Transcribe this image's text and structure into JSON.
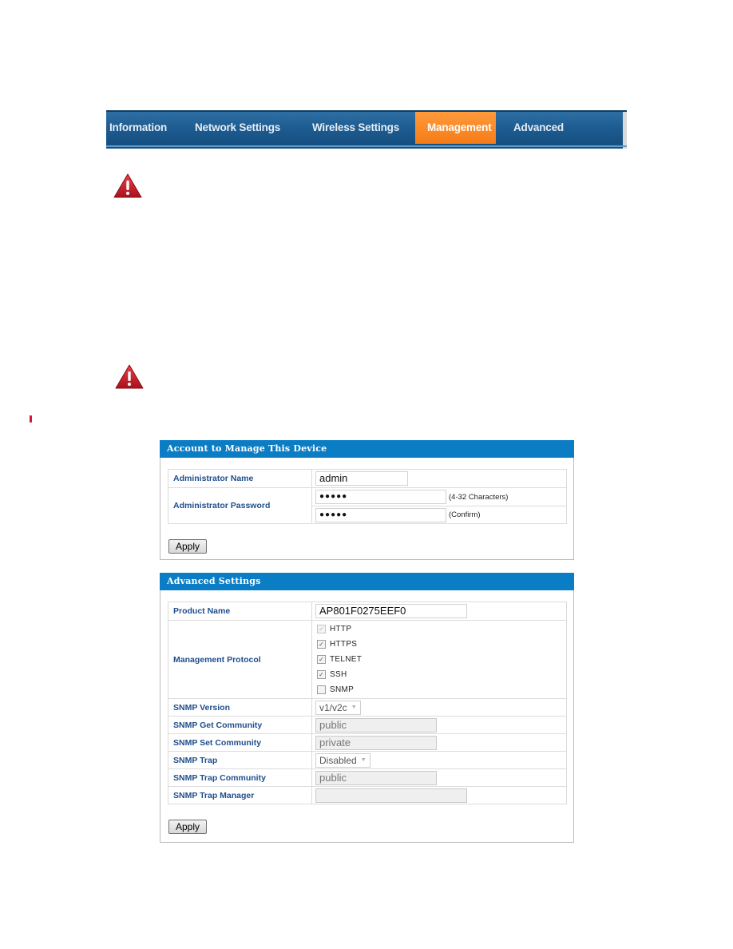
{
  "nav": {
    "items": [
      {
        "label": "Information",
        "active": false
      },
      {
        "label": "Network Settings",
        "active": false
      },
      {
        "label": "Wireless Settings",
        "active": false
      },
      {
        "label": "Management",
        "active": true
      },
      {
        "label": "Advanced",
        "active": false
      }
    ],
    "colors": {
      "bar": "#1d5b90",
      "active": "#f57c17"
    }
  },
  "icons": {
    "warning_1": "warning-triangle-icon",
    "warning_2": "warning-triangle-icon"
  },
  "account_panel": {
    "title": "Account to Manage This Device",
    "admin_name_label": "Administrator Name",
    "admin_name_value": "admin",
    "admin_password_label": "Administrator Password",
    "password_mask": "●●●●●",
    "password_hint": "(4-32 Characters)",
    "confirm_mask": "●●●●●",
    "confirm_hint": "(Confirm)",
    "apply_label": "Apply"
  },
  "advanced_panel": {
    "title": "Advanced Settings",
    "product_name_label": "Product Name",
    "product_name_value": "AP801F0275EEF0",
    "mgmt_protocol_label": "Management Protocol",
    "protocols": [
      {
        "label": "HTTP",
        "checked": true,
        "disabled": true
      },
      {
        "label": "HTTPS",
        "checked": true,
        "disabled": false
      },
      {
        "label": "TELNET",
        "checked": true,
        "disabled": false
      },
      {
        "label": "SSH",
        "checked": true,
        "disabled": false
      },
      {
        "label": "SNMP",
        "checked": false,
        "disabled": false
      }
    ],
    "snmp_version_label": "SNMP Version",
    "snmp_version_value": "v1/v2c",
    "snmp_get_label": "SNMP Get Community",
    "snmp_get_value": "public",
    "snmp_set_label": "SNMP Set Community",
    "snmp_set_value": "private",
    "snmp_trap_label": "SNMP Trap",
    "snmp_trap_value": "Disabled",
    "snmp_trap_community_label": "SNMP Trap Community",
    "snmp_trap_community_value": "public",
    "snmp_trap_manager_label": "SNMP Trap Manager",
    "snmp_trap_manager_value": "",
    "apply_label": "Apply"
  },
  "colors": {
    "panel_header": "#0a7dc4",
    "label_text": "#1e4e8c"
  }
}
